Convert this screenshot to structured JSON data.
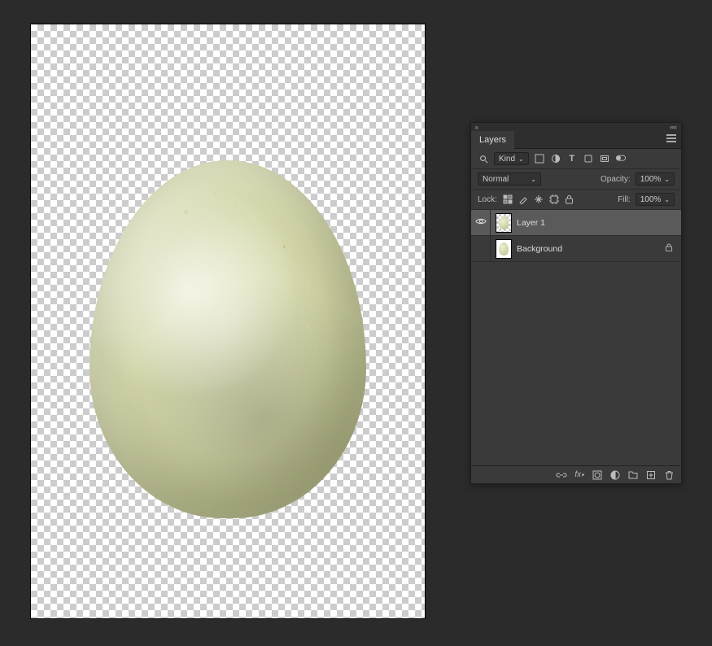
{
  "panel": {
    "title": "Layers",
    "filter": {
      "search_icon": "search",
      "kind_label": "Kind"
    },
    "blend": {
      "mode": "Normal",
      "opacity_label": "Opacity:",
      "opacity_value": "100%"
    },
    "lock": {
      "label": "Lock:",
      "fill_label": "Fill:",
      "fill_value": "100%"
    },
    "layers": [
      {
        "name": "Layer 1",
        "visible": true,
        "selected": true,
        "locked": false
      },
      {
        "name": "Background",
        "visible": false,
        "selected": false,
        "locked": true
      }
    ]
  },
  "canvas": {
    "subject": "egg on transparent background"
  }
}
